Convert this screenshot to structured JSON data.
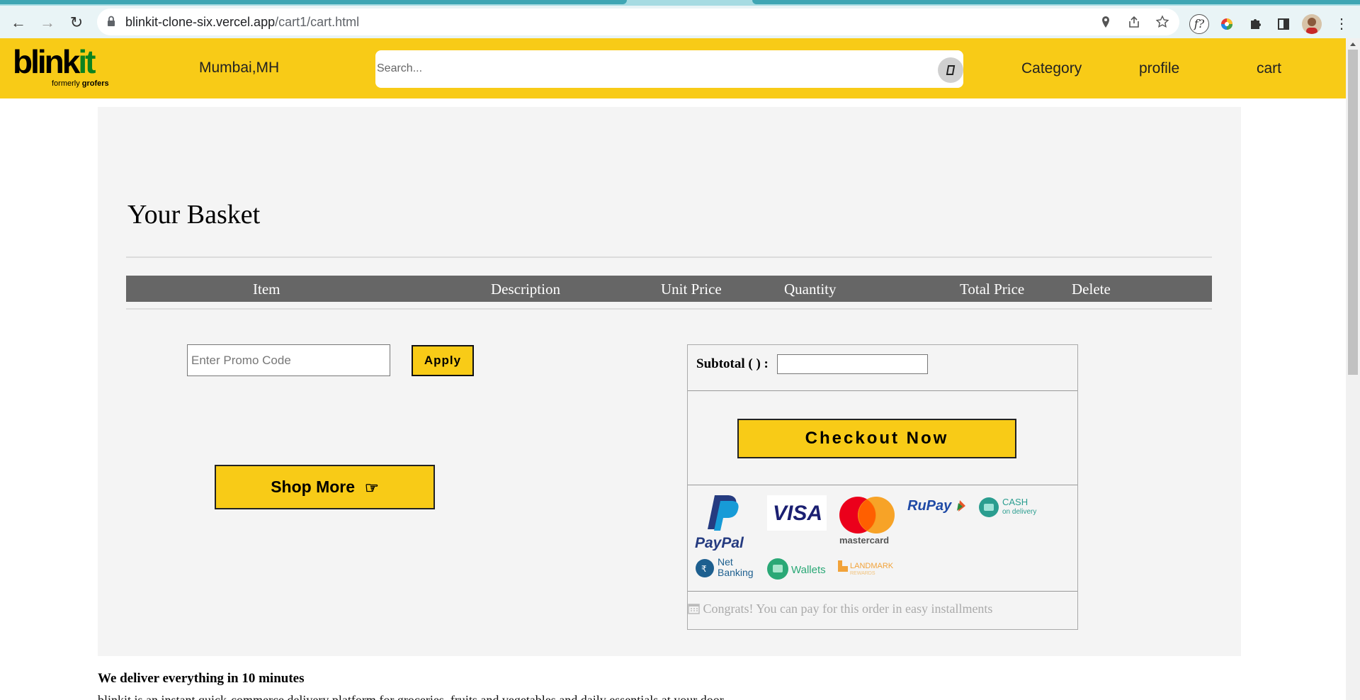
{
  "browser": {
    "url_host": "blinkit-clone-six.vercel.app",
    "url_path": "/cart1/cart.html"
  },
  "header": {
    "logo_main": "blink",
    "logo_accent": "it",
    "logo_sub_prefix": "formerly ",
    "logo_sub_brand": "grofers",
    "location": "Mumbai,MH",
    "search_placeholder": "Search...",
    "nav": {
      "category": "Category",
      "profile": "profile",
      "cart": "cart"
    }
  },
  "basket": {
    "title": "Your Basket",
    "columns": [
      "Item",
      "Description",
      "Unit Price",
      "Quantity",
      "Total Price",
      "Delete"
    ],
    "promo_placeholder": "Enter Promo Code",
    "apply_label": "Apply",
    "shop_more_label": "Shop More",
    "subtotal_label": "Subtotal ( ) :",
    "subtotal_value": "",
    "checkout_label": "Checkout Now",
    "payment_labels": {
      "paypal": "PayPal",
      "visa": "VISA",
      "mastercard": "mastercard",
      "rupay": "RuPay",
      "cash_top": "CASH",
      "cash_bottom": "on delivery",
      "netbanking_top": "Net",
      "netbanking_bottom": "Banking",
      "wallets": "Wallets",
      "landmark_top": "LANDMARK",
      "landmark_bottom": "REWARDS"
    },
    "installment_text": "Congrats! You can pay for this order in easy installments"
  },
  "footer": {
    "title": "We deliver everything in 10 minutes",
    "text": "blinkit is an instant quick-commerce delivery platform for groceries, fruits and vegetables and daily essentials at your door"
  },
  "colors": {
    "brand_yellow": "#f8cb17",
    "brand_green": "#0c831f",
    "table_header": "#666666",
    "card_bg": "#f4f4f4"
  }
}
